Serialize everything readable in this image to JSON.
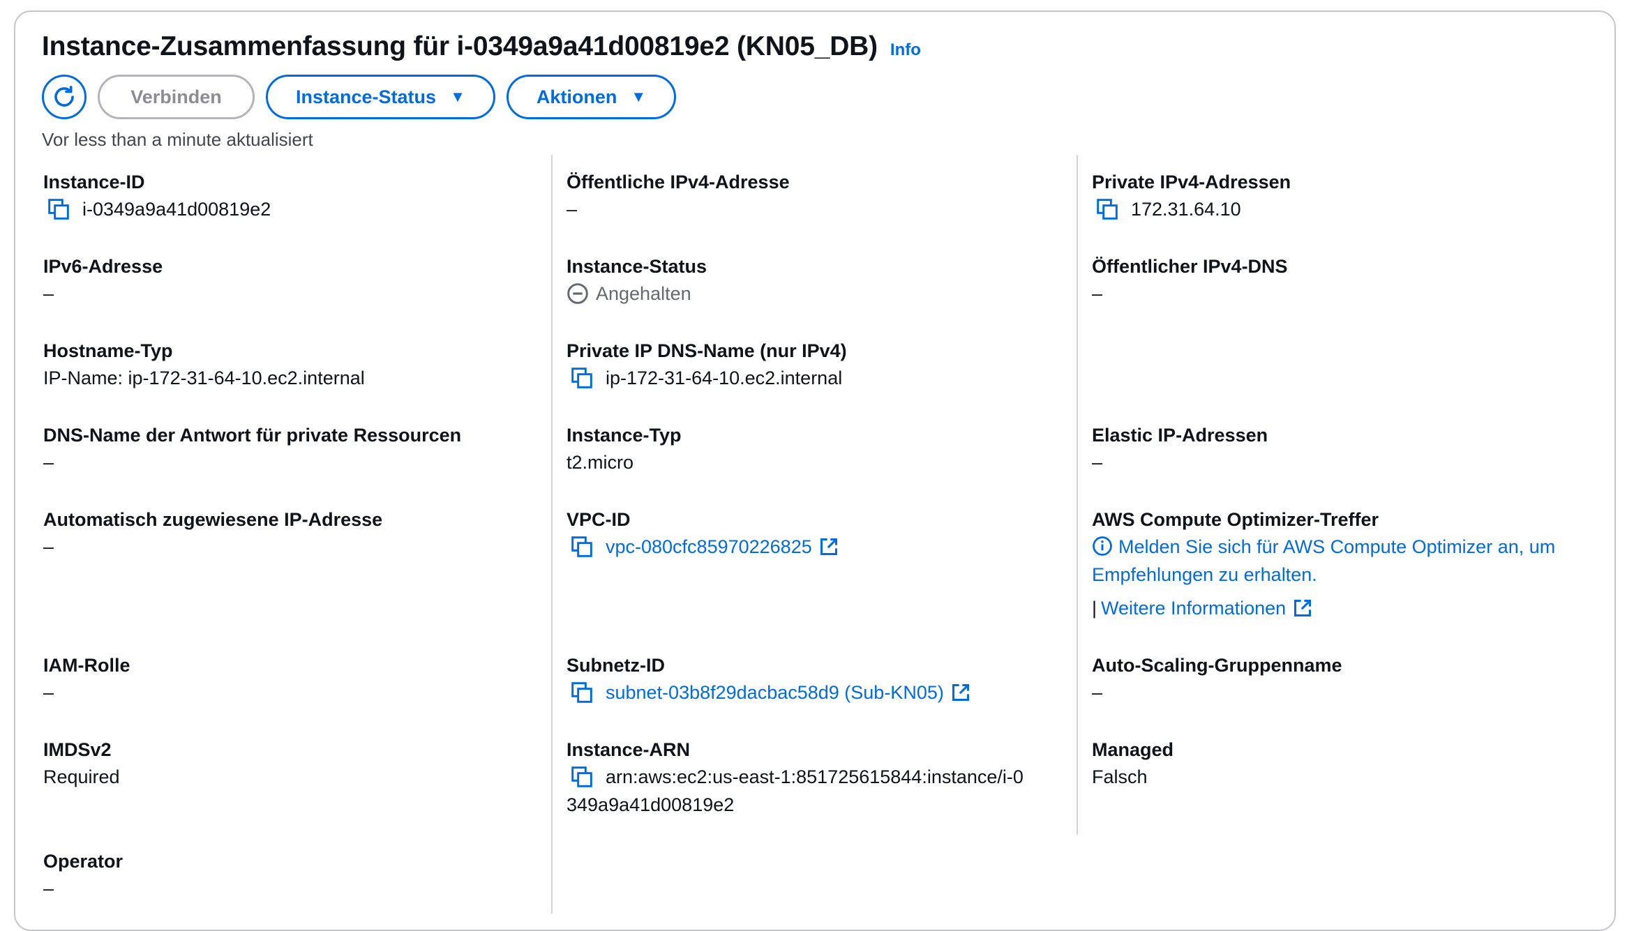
{
  "header": {
    "title": "Instance-Zusammenfassung für i-0349a9a41d00819e2 (KN05_DB)",
    "info_label": "Info",
    "connect_label": "Verbinden",
    "instance_status_label": "Instance-Status",
    "actions_label": "Aktionen",
    "updated_text": "Vor less than a minute aktualisiert"
  },
  "col1": {
    "instance_id_label": "Instance-ID",
    "instance_id_value": "i-0349a9a41d00819e2",
    "ipv6_label": "IPv6-Adresse",
    "ipv6_value": "–",
    "hostname_type_label": "Hostname-Typ",
    "hostname_type_value": "IP-Name: ip-172-31-64-10.ec2.internal",
    "dns_answer_label": "DNS-Name der Antwort für private Ressourcen",
    "dns_answer_value": "–",
    "auto_ip_label": "Automatisch zugewiesene IP-Adresse",
    "auto_ip_value": "–",
    "iam_label": "IAM-Rolle",
    "iam_value": "–",
    "imds_label": "IMDSv2",
    "imds_value": "Required",
    "operator_label": "Operator",
    "operator_value": "–"
  },
  "col2": {
    "public_ipv4_label": "Öffentliche IPv4-Adresse",
    "public_ipv4_value": "–",
    "instance_status_label": "Instance-Status",
    "instance_status_value": "Angehalten",
    "private_dns_label": "Private IP DNS-Name (nur IPv4)",
    "private_dns_value": "ip-172-31-64-10.ec2.internal",
    "instance_type_label": "Instance-Typ",
    "instance_type_value": "t2.micro",
    "vpc_label": "VPC-ID",
    "vpc_value": "vpc-080cfc85970226825",
    "subnet_label": "Subnetz-ID",
    "subnet_value": "subnet-03b8f29dacbac58d9 (Sub-KN05)",
    "arn_label": "Instance-ARN",
    "arn_value_line1": "arn:aws:ec2:us-east-1:851725615844:instance/i-0",
    "arn_value_line2": "349a9a41d00819e2"
  },
  "col3": {
    "private_ipv4_label": "Private IPv4-Adressen",
    "private_ipv4_value": "172.31.64.10",
    "public_dns_label": "Öffentlicher IPv4-DNS",
    "public_dns_value": "–",
    "elastic_ip_label": "Elastic IP-Adressen",
    "elastic_ip_value": "–",
    "optimizer_label": "AWS Compute Optimizer-Treffer",
    "optimizer_link_line1": "Melden Sie sich für AWS Compute Optimizer an, um",
    "optimizer_link_line2": "Empfehlungen zu erhalten.",
    "more_info_sep": "|",
    "more_info_link": "Weitere Informationen",
    "asg_label": "Auto-Scaling-Gruppenname",
    "asg_value": "–",
    "managed_label": "Managed",
    "managed_value": "Falsch"
  },
  "colors": {
    "accent": "#006ce0",
    "border": "#c6c6cd",
    "text": "#0f141a",
    "muted": "#656871"
  }
}
